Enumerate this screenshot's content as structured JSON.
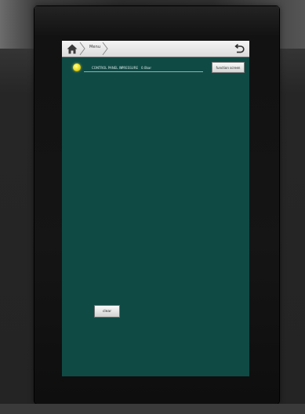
{
  "nav": {
    "home_icon": "home-icon",
    "breadcrumb": "Menu",
    "back_icon": "back-arrow-icon"
  },
  "status": {
    "led_color": "#f2e22a",
    "label_1": "CONTROL PANEL IN",
    "label_2": "PRESSURE",
    "value": "0.0bar",
    "function_button": "function screen"
  },
  "actions": {
    "clear_label": "clear"
  },
  "colors": {
    "screen_bg": "#0f4a45",
    "nav_bg": "#e6e6e6",
    "bezel": "#111111"
  }
}
